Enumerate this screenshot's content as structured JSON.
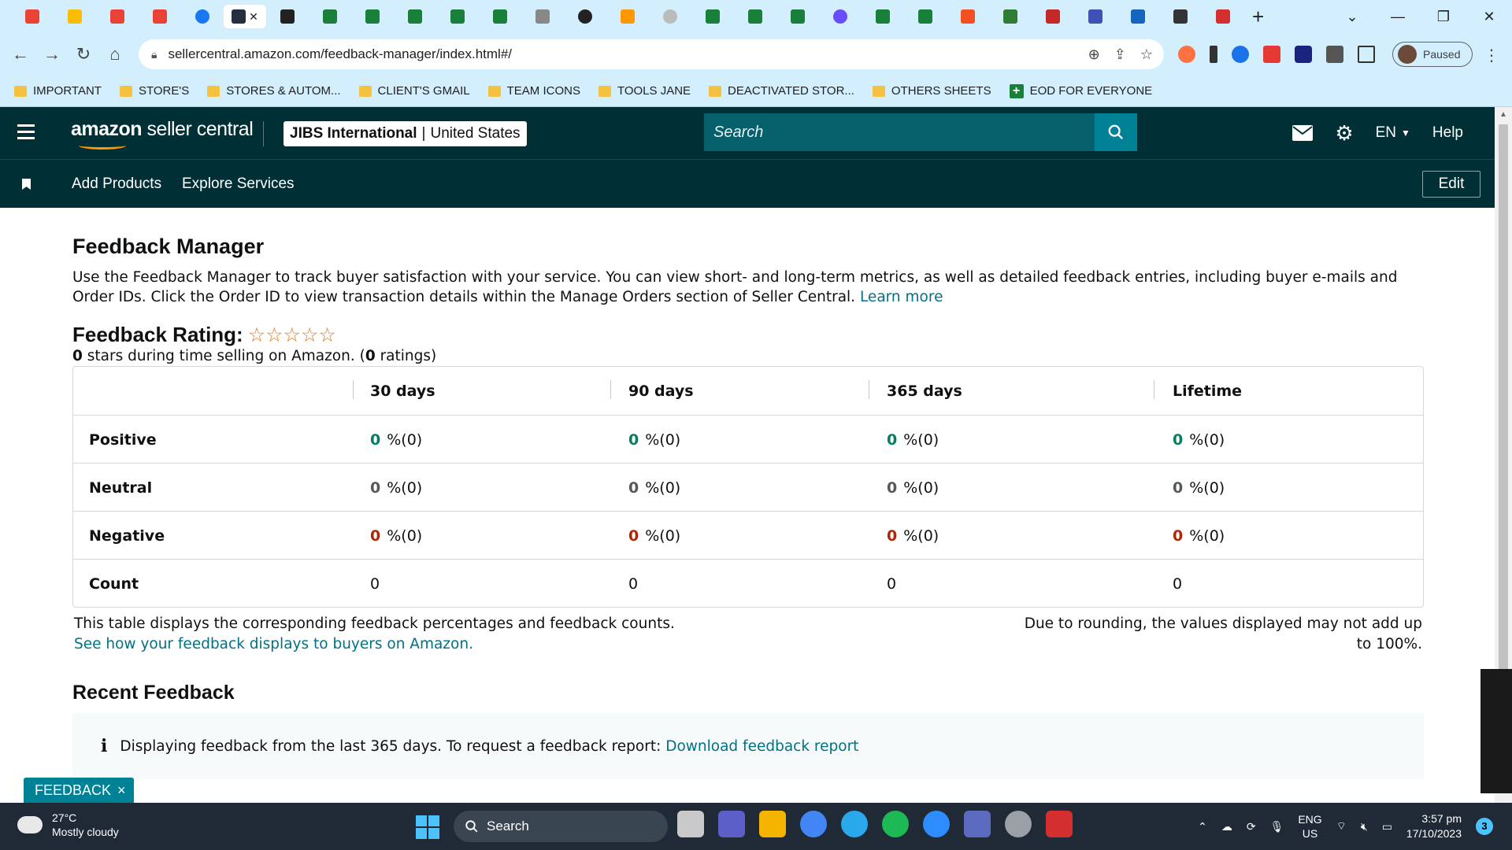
{
  "browser": {
    "url": "sellercentral.amazon.com/feedback-manager/index.html#/",
    "profile_label": "Paused",
    "bookmarks": [
      {
        "label": "IMPORTANT",
        "icon": "folder-icon"
      },
      {
        "label": "STORE'S",
        "icon": "folder-icon"
      },
      {
        "label": "STORES & AUTOM...",
        "icon": "folder-icon"
      },
      {
        "label": "CLIENT'S GMAIL",
        "icon": "folder-icon"
      },
      {
        "label": "TEAM ICONS",
        "icon": "folder-icon"
      },
      {
        "label": "TOOLS JANE",
        "icon": "folder-icon"
      },
      {
        "label": "DEACTIVATED STOR...",
        "icon": "folder-icon"
      },
      {
        "label": "OTHERS SHEETS",
        "icon": "folder-icon"
      },
      {
        "label": "EOD FOR EVERYONE",
        "icon": "sheets-plus-icon"
      }
    ]
  },
  "header": {
    "logo_bold": "amazon",
    "logo_rest": " seller central",
    "store_name": "JIBS International",
    "store_sep": "|",
    "store_region": "United States",
    "search_placeholder": "Search",
    "lang": "EN",
    "help": "Help"
  },
  "nav": {
    "add_products": "Add Products",
    "explore_services": "Explore Services",
    "edit": "Edit"
  },
  "page": {
    "title": "Feedback Manager",
    "intro": "Use the Feedback Manager to track buyer satisfaction with your service. You can view short- and long-term metrics, as well as detailed feedback entries, including buyer e-mails and Order IDs. Click the Order ID to view transaction details within the Manage Orders section of Seller Central.",
    "learn_more": "Learn more",
    "rating_title": "Feedback Rating:",
    "stars": "☆☆☆☆☆",
    "rating_stars_value": "0",
    "rating_mid": " stars during time selling on Amazon. (",
    "rating_count": "0",
    "rating_end": " ratings)",
    "columns": [
      "30 days",
      "90 days",
      "365 days",
      "Lifetime"
    ],
    "rows": [
      {
        "label": "Positive",
        "values": [
          [
            "0",
            "%(0)"
          ],
          [
            "0",
            "%(0)"
          ],
          [
            "0",
            "%(0)"
          ],
          [
            "0",
            "%(0)"
          ]
        ]
      },
      {
        "label": "Neutral",
        "values": [
          [
            "0",
            "%(0)"
          ],
          [
            "0",
            "%(0)"
          ],
          [
            "0",
            "%(0)"
          ],
          [
            "0",
            "%(0)"
          ]
        ]
      },
      {
        "label": "Negative",
        "values": [
          [
            "0",
            "%(0)"
          ],
          [
            "0",
            "%(0)"
          ],
          [
            "0",
            "%(0)"
          ],
          [
            "0",
            "%(0)"
          ]
        ]
      },
      {
        "label": "Count",
        "values": [
          "0",
          "0",
          "0",
          "0"
        ]
      }
    ],
    "note_left_1": "This table displays the corresponding feedback percentages and feedback counts.",
    "note_left_link": "See how your feedback displays to buyers on Amazon.",
    "note_right_1": "Due to rounding, the values displayed may not add up",
    "note_right_2": "to 100%.",
    "recent_title": "Recent Feedback",
    "info_icon": "i",
    "info_text": "Displaying feedback from the last 365 days. To request a feedback report:",
    "info_link": "Download feedback report",
    "feedback_tab": "FEEDBACK",
    "feedback_close": "×"
  },
  "colors": {
    "header_bg": "#002f36",
    "search_btn": "#008296",
    "link": "#007185",
    "positive": "#067d62",
    "negative": "#b12704"
  },
  "taskbar": {
    "temp": "27°C",
    "weather": "Mostly cloudy",
    "search": "Search",
    "lang_1": "ENG",
    "lang_2": "US",
    "time": "3:57 pm",
    "date": "17/10/2023",
    "notif_count": "3"
  }
}
